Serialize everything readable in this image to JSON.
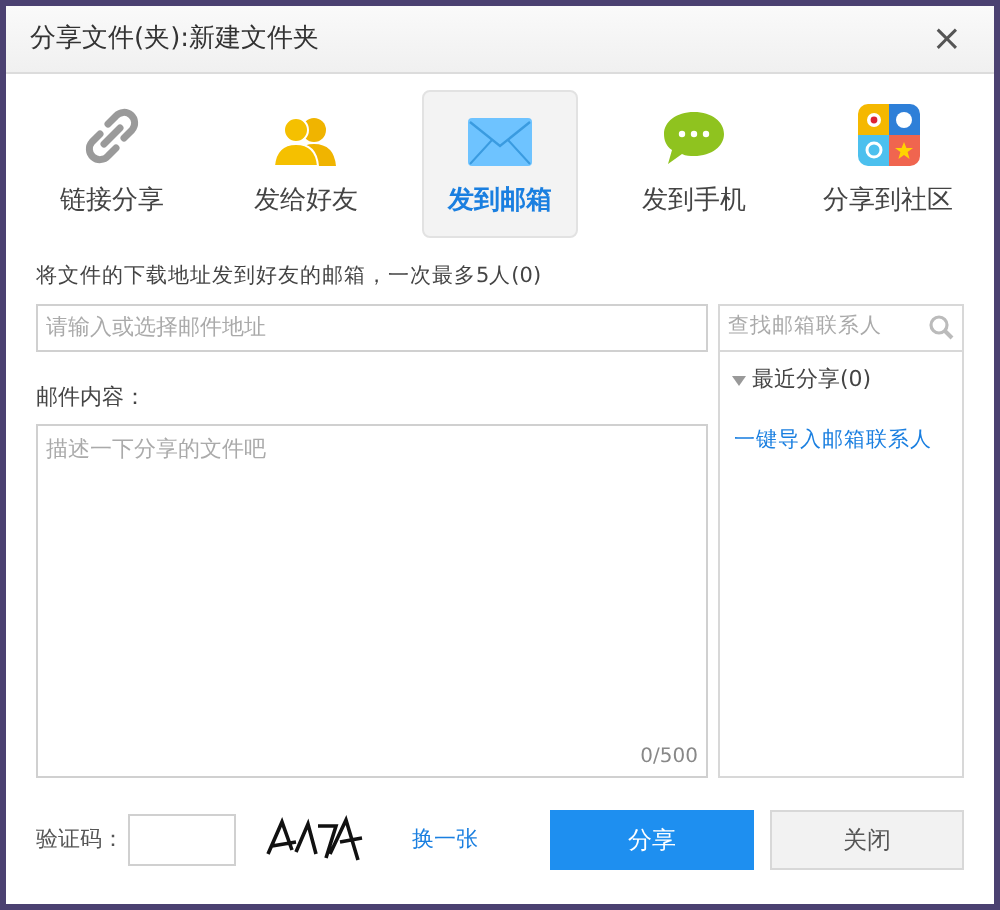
{
  "window": {
    "title": "分享文件(夹):新建文件夹",
    "close": "×"
  },
  "tabs": [
    {
      "label": "链接分享",
      "kind": "link",
      "selected": false
    },
    {
      "label": "发给好友",
      "kind": "friends",
      "selected": false
    },
    {
      "label": "发到邮箱",
      "kind": "mail",
      "selected": true
    },
    {
      "label": "发到手机",
      "kind": "phone",
      "selected": false
    },
    {
      "label": "分享到社区",
      "kind": "community",
      "selected": false
    }
  ],
  "instruction": "将文件的下载地址发到好友的邮箱，一次最多5人(0)",
  "email_field": {
    "placeholder": "请输入或选择邮件地址"
  },
  "content_label": "邮件内容：",
  "content_field": {
    "placeholder": "描述一下分享的文件吧",
    "counter": "0/500"
  },
  "contacts": {
    "search_placeholder": "查找邮箱联系人",
    "group": "最近分享(0)",
    "expanded": true,
    "import_link": "一键导入邮箱联系人"
  },
  "captcha": {
    "label": "验证码：",
    "refresh": "换一张"
  },
  "buttons": [
    {
      "label": "分享",
      "kind": "primary"
    },
    {
      "label": "关闭",
      "kind": "secondary"
    }
  ]
}
